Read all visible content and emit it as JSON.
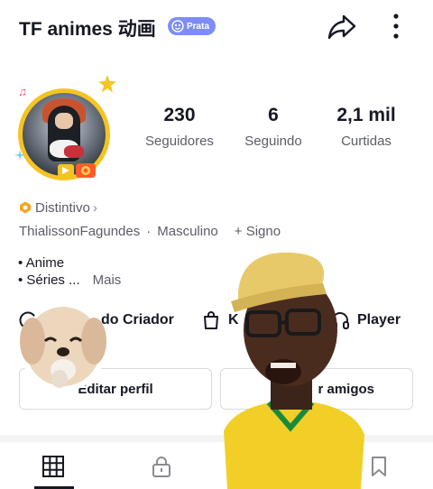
{
  "header": {
    "title": "TF animes 动画",
    "badge_label": "Prata",
    "badge_color": "#7d8df5"
  },
  "stats": [
    {
      "value": "230",
      "label": "Seguidores"
    },
    {
      "value": "6",
      "label": "Seguindo"
    },
    {
      "value": "2,1 mil",
      "label": "Curtidas"
    }
  ],
  "distintivo": {
    "label": "Distintivo",
    "chevron": "›"
  },
  "info": {
    "username": "ThialissonFagundes",
    "separator": "·",
    "gender": "Masculino",
    "signo": "+ Signo"
  },
  "bio": {
    "line1": "• Anime",
    "line2": "• Séries ...",
    "more": "Mais"
  },
  "links": {
    "creator": "do Criador",
    "shop": "K",
    "player": "Player"
  },
  "buttons": {
    "edit_profile": "Editar perfil",
    "add_friends": "r amigos"
  },
  "colors": {
    "text_primary": "#161823",
    "text_secondary": "#5b5d66",
    "border": "#dadbde",
    "avatar_ring": "#f5c423"
  }
}
